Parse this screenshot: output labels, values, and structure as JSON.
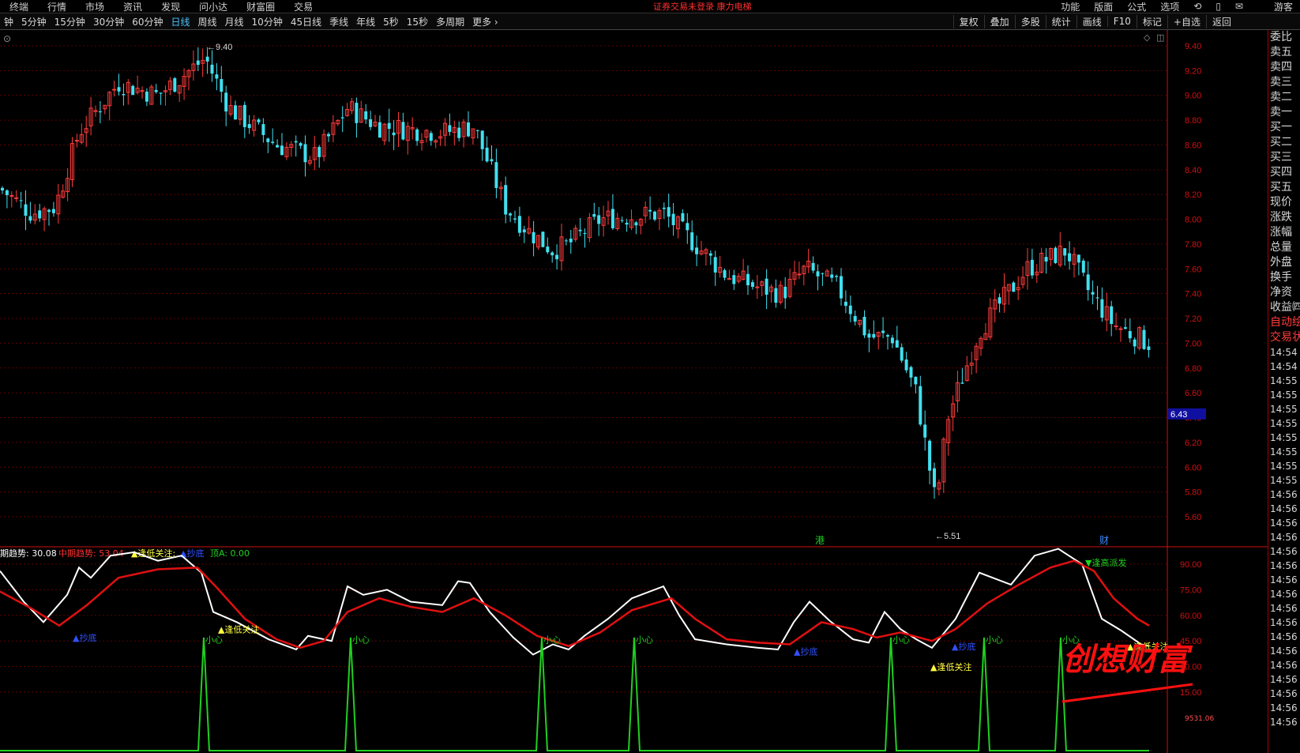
{
  "menubar": {
    "items": [
      "终端",
      "行情",
      "市场",
      "资讯",
      "发现",
      "问小达",
      "财富圈",
      "交易"
    ],
    "warning": "证券交易未登录   康力电梯",
    "right_items": [
      "功能",
      "版面",
      "公式",
      "选项"
    ],
    "user": "游客"
  },
  "periodbar": {
    "items": [
      "钟",
      "5分钟",
      "15分钟",
      "30分钟",
      "60分钟",
      "日线",
      "周线",
      "月线",
      "10分钟",
      "45日线",
      "季线",
      "年线",
      "5秒",
      "15秒",
      "多周期",
      "更多 ›"
    ],
    "active": "日线",
    "right_items": [
      "复权",
      "叠加",
      "多股",
      "统计",
      "画线",
      "F10",
      "标记",
      "+自选",
      "返回"
    ]
  },
  "colors": {
    "up": "#ff3b3b",
    "down": "#40e0f0",
    "grid": "#5a0000",
    "axis_red": "#d01010",
    "short_trend": "#ffffff",
    "mid_trend": "#e01010",
    "signal": "#20d020",
    "buy_label": "#3050ff",
    "focus_label": "#ffff40",
    "price_tag_bg": "#1010a0"
  },
  "icons": [
    "collapse-icon",
    "diamond-icon",
    "panel-toggle-icon",
    "refresh-icon",
    "phone-icon",
    "mail-icon"
  ],
  "main_chart": {
    "y_labels": [
      "9.40",
      "9.20",
      "9.00",
      "8.80",
      "8.60",
      "8.40",
      "8.20",
      "8.00",
      "7.80",
      "7.60",
      "7.40",
      "7.20",
      "7.00",
      "6.80",
      "6.60",
      "6.40",
      "6.20",
      "6.00",
      "5.80",
      "5.60"
    ],
    "ylim": [
      5.5,
      9.45
    ],
    "high_label": "9.40",
    "low_label": "5.51",
    "current_price_tag": "6.43",
    "markers": [
      {
        "text": "港",
        "color": "#20d020"
      },
      {
        "text": "财",
        "color": "#3b8bff"
      }
    ]
  },
  "indicator": {
    "legend": [
      {
        "text": "期趋势: 30.08",
        "color": "#ffffff"
      },
      {
        "text": "中期趋势: 53.04",
        "color": "#ff3030"
      },
      {
        "text": "▲逢低关注:",
        "color": "#ffff40"
      },
      {
        "text": "▲抄底",
        "color": "#3050ff"
      },
      {
        "text": "顶A: 0.00",
        "color": "#20d020"
      }
    ],
    "y_labels": [
      "90.00",
      "75.00",
      "60.00",
      "45.00",
      "30.00",
      "15.00"
    ],
    "ylim": [
      0,
      100
    ],
    "signal_labels": {
      "xiaoxin": "小心",
      "dip": "▲逢低关注",
      "buy": "▲抄底",
      "top_sell": "▼逢高派发"
    },
    "watermark": "创想财富",
    "corner_value": "9531.06"
  },
  "right_panel": {
    "labels": [
      "委比",
      "卖五",
      "卖四",
      "卖三",
      "卖二",
      "卖一",
      "买一",
      "买二",
      "买三",
      "买四",
      "买五",
      "现价",
      "涨跌",
      "涨幅",
      "总量",
      "外盘",
      "换手",
      "净资",
      "收益㈣"
    ],
    "red_labels": [
      "自动绘",
      "交易状"
    ],
    "times": [
      "14:54",
      "14:54",
      "14:55",
      "14:55",
      "14:55",
      "14:55",
      "14:55",
      "14:55",
      "14:55",
      "14:55",
      "14:56",
      "14:56",
      "14:56",
      "14:56",
      "14:56",
      "14:56",
      "14:56",
      "14:56",
      "14:56",
      "14:56",
      "14:56",
      "14:56",
      "14:56",
      "14:56",
      "14:56",
      "14:56",
      "14:56"
    ]
  }
}
